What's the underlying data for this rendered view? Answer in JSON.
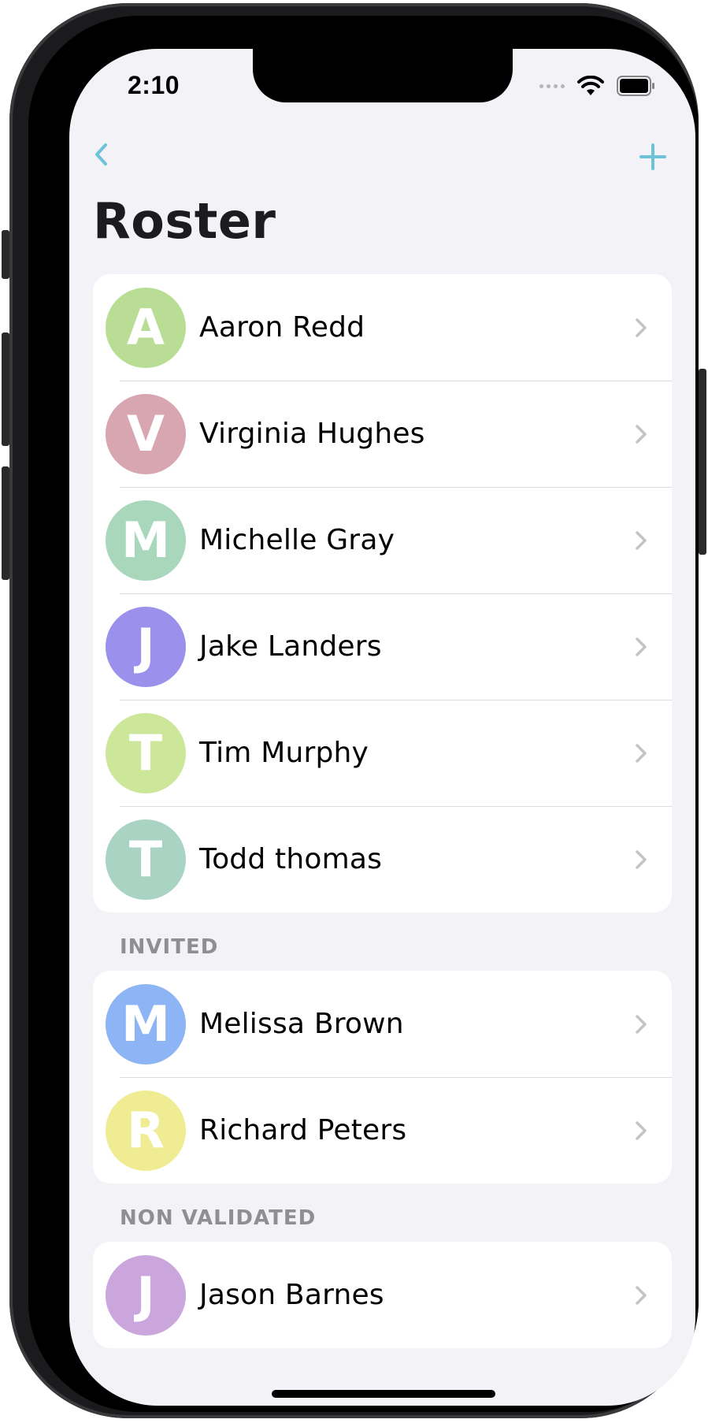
{
  "status_bar": {
    "time": "2:10"
  },
  "nav": {
    "title": "Roster"
  },
  "roster": [
    {
      "initial": "A",
      "name": "Aaron Redd",
      "color": "#b9dd95"
    },
    {
      "initial": "V",
      "name": "Virginia Hughes",
      "color": "#d8a6b1"
    },
    {
      "initial": "M",
      "name": "Michelle Gray",
      "color": "#a8d7bc"
    },
    {
      "initial": "J",
      "name": "Jake Landers",
      "color": "#9b91ec"
    },
    {
      "initial": "T",
      "name": "Tim Murphy",
      "color": "#cde79a"
    },
    {
      "initial": "T",
      "name": "Todd thomas",
      "color": "#a9d3c3"
    }
  ],
  "invited": {
    "header": "INVITED",
    "members": [
      {
        "initial": "M",
        "name": "Melissa Brown",
        "color": "#8db4f4"
      },
      {
        "initial": "R",
        "name": "Richard Peters",
        "color": "#efec94"
      }
    ]
  },
  "non_validated": {
    "header": "NON VALIDATED",
    "members": [
      {
        "initial": "J",
        "name": "Jason Barnes",
        "color": "#cba6dd"
      }
    ]
  },
  "colors": {
    "accent": "#6cc3d9",
    "background": "#f2f2f7"
  }
}
